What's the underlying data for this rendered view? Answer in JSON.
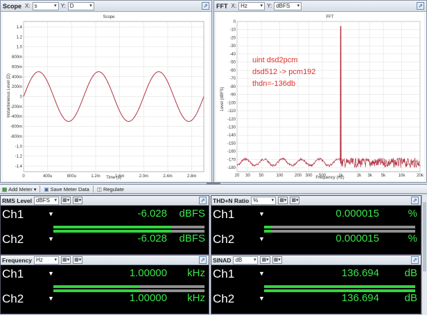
{
  "scope": {
    "title": "Scope",
    "x_label": "X:",
    "x_value": "s",
    "y_label": "Y:",
    "y_value": "D",
    "chart_data": {
      "type": "line",
      "title": "Scope",
      "xlabel": "Time (s)",
      "ylabel": "Instantaneous Level (D)",
      "xlim": [
        0,
        0.003
      ],
      "ylim": [
        -1.45,
        1.45
      ],
      "x_ticks": [
        "0",
        "400u",
        "800u",
        "1.2m",
        "1.6m",
        "2.0m",
        "2.4m",
        "2.8m"
      ],
      "y_ticks": [
        "1.4",
        "1.2",
        "1.0",
        "800m",
        "600m",
        "400m",
        "200m",
        "0",
        "-200m",
        "-400m",
        "-600m",
        "-800m",
        "-1.0",
        "-1.2",
        "-1.4"
      ],
      "series": [
        {
          "frequency_hz": 1000,
          "amplitude": 0.5,
          "color": "#b03040"
        }
      ],
      "grid": true
    }
  },
  "fft": {
    "title": "FFT",
    "x_label": "X:",
    "x_value": "Hz",
    "y_label": "Y:",
    "y_value": "dBFS",
    "annotation": [
      "uint dsd2pcm",
      "dsd512 -> pcm192",
      "thdn=-136db"
    ],
    "chart_data": {
      "type": "line",
      "title": "FFT",
      "xlabel": "Frequency (Hz)",
      "ylabel": "Level (dBFS)",
      "xscale": "log",
      "xlim": [
        20,
        20000
      ],
      "ylim": [
        -185,
        0
      ],
      "x_ticks": [
        "20",
        "30",
        "50",
        "100",
        "200",
        "300",
        "500",
        "1k",
        "2k",
        "3k",
        "5k",
        "10k",
        "20k"
      ],
      "y_ticks": [
        "0",
        "-10",
        "-20",
        "-30",
        "-40",
        "-50",
        "-60",
        "-70",
        "-80",
        "-90",
        "-100",
        "-110",
        "-120",
        "-130",
        "-140",
        "-150",
        "-160",
        "-170",
        "-180"
      ],
      "peak": {
        "frequency_hz": 1000,
        "level_dbfs": -6
      },
      "noise_floor_dbfs": [
        -170,
        -176
      ],
      "grid": true
    }
  },
  "toolbar": {
    "add_meter": "Add Meter",
    "save_meter_data": "Save Meter Data",
    "regulate": "Regulate"
  },
  "meters": {
    "rms": {
      "title": "RMS Level",
      "unit_select": "dBFS",
      "ch1": {
        "name": "Ch1",
        "value": "-6.028",
        "unit": "dBFS",
        "level": 0.78
      },
      "ch2": {
        "name": "Ch2",
        "value": "-6.028",
        "unit": "dBFS",
        "level": 0.78
      }
    },
    "thdn": {
      "title": "THD+N Ratio",
      "unit_select": "%",
      "ch1": {
        "name": "Ch1",
        "value": "0.000015",
        "unit": "%",
        "level": 0.05
      },
      "ch2": {
        "name": "Ch2",
        "value": "0.000015",
        "unit": "%",
        "level": 0.05
      }
    },
    "freq": {
      "title": "Frequency",
      "unit_select": "Hz",
      "ch1": {
        "name": "Ch1",
        "value": "1.00000",
        "unit": "kHz",
        "level": 0.57
      },
      "ch2": {
        "name": "Ch2",
        "value": "1.00000",
        "unit": "kHz",
        "level": 0.57
      }
    },
    "sinad": {
      "title": "SINAD",
      "unit_select": "dB",
      "ch1": {
        "name": "Ch1",
        "value": "136.694",
        "unit": "dB",
        "level": 1.0
      },
      "ch2": {
        "name": "Ch2",
        "value": "136.694",
        "unit": "dB",
        "level": 1.0
      }
    }
  }
}
